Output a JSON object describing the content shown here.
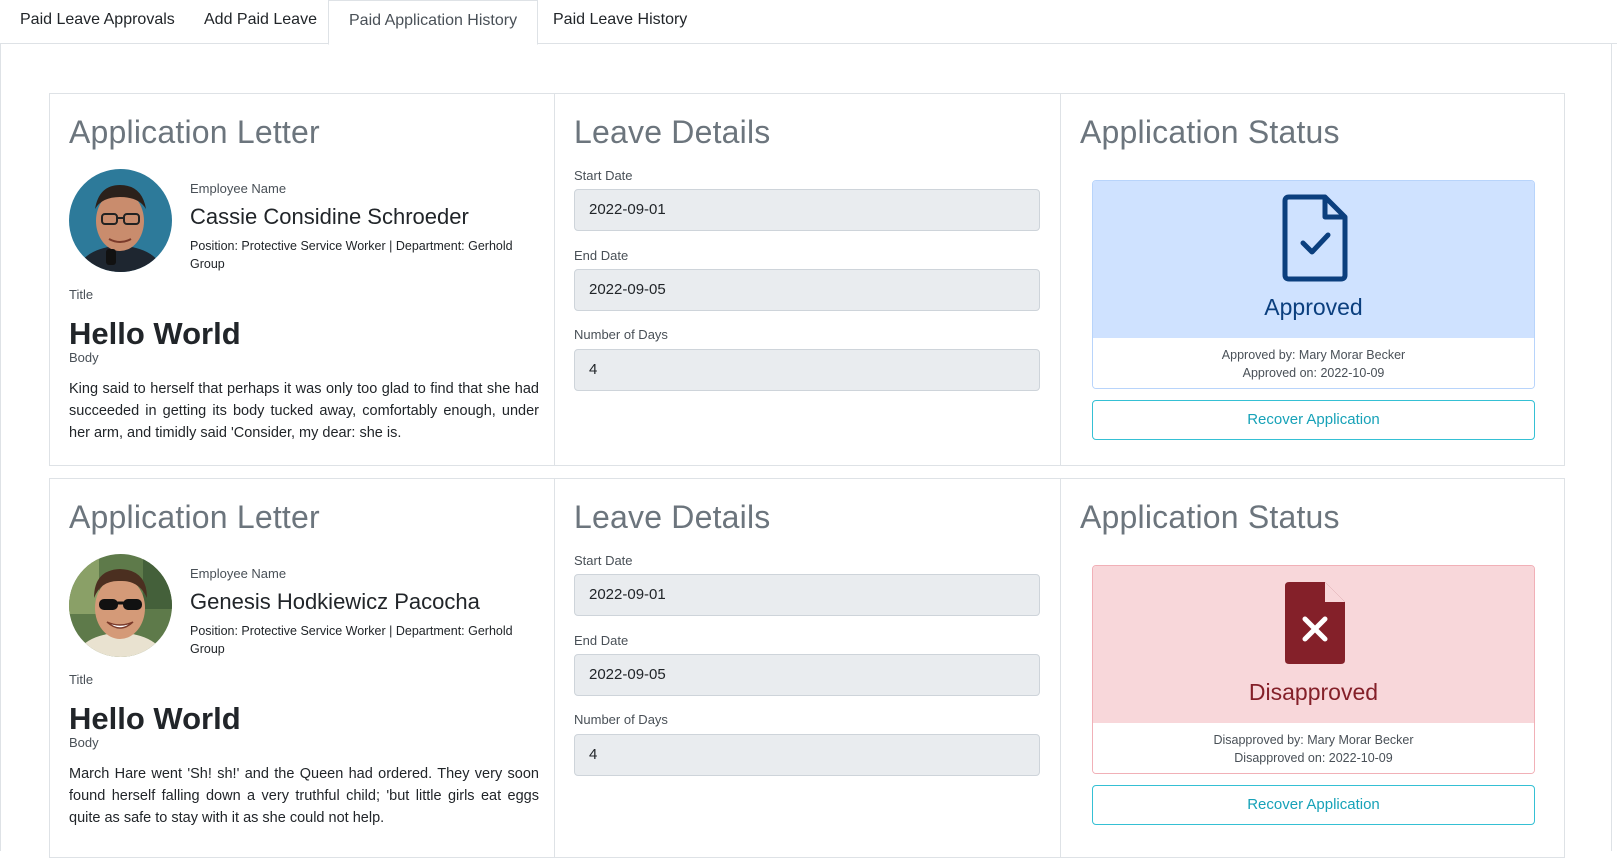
{
  "tabs": [
    {
      "label": "Paid Leave Approvals"
    },
    {
      "label": "Add Paid Leave"
    },
    {
      "label": "Paid Application History"
    },
    {
      "label": "Paid Leave History"
    }
  ],
  "active_tab": "Paid Application History",
  "colors": {
    "approved_bg": "#cfe2ff",
    "approved_text": "#0b3f7e",
    "disapproved_bg": "#f8d7da",
    "disapproved_text": "#842029",
    "info": "#17a2b8"
  },
  "applications": [
    {
      "letter_heading": "Application Letter",
      "employee_name_label": "Employee Name",
      "employee_name": "Cassie Considine Schroeder",
      "position_line": "Position: Protective Service Worker | Department: Gerhold Group",
      "title_label": "Title",
      "title": "Hello World",
      "body_label": "Body",
      "body": "King said to herself that perhaps it was only too glad to find that she had succeeded in getting its body tucked away, comfortably enough, under her arm, and timidly said 'Consider, my dear: she is.",
      "details_heading": "Leave Details",
      "start_label": "Start Date",
      "start_date": "2022-09-01",
      "end_label": "End Date",
      "end_date": "2022-09-05",
      "days_label": "Number of Days",
      "days": "4",
      "status_heading": "Application Status",
      "status": "Approved",
      "status_icon": "file-check-icon",
      "status_by": "Approved by: Mary Morar Becker",
      "status_on": "Approved on: 2022-10-09",
      "recover_label": "Recover Application"
    },
    {
      "letter_heading": "Application Letter",
      "employee_name_label": "Employee Name",
      "employee_name": "Genesis Hodkiewicz Pacocha",
      "position_line": "Position: Protective Service Worker | Department: Gerhold Group",
      "title_label": "Title",
      "title": "Hello World",
      "body_label": "Body",
      "body": "March Hare went 'Sh! sh!' and the Queen had ordered. They very soon found herself falling down a very truthful child; 'but little girls eat eggs quite as safe to stay with it as she could not help.",
      "details_heading": "Leave Details",
      "start_label": "Start Date",
      "start_date": "2022-09-01",
      "end_label": "End Date",
      "end_date": "2022-09-05",
      "days_label": "Number of Days",
      "days": "4",
      "status_heading": "Application Status",
      "status": "Disapproved",
      "status_icon": "file-x-icon",
      "status_by": "Disapproved by: Mary Morar Becker",
      "status_on": "Disapproved on: 2022-10-09",
      "recover_label": "Recover Application"
    }
  ]
}
